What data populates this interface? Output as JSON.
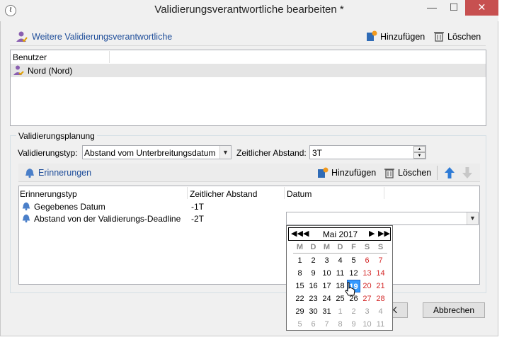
{
  "window": {
    "title": "Validierungsverantwortliche bearbeiten *"
  },
  "responsibles": {
    "section_label": "Weitere Validierungsverantwortliche",
    "add_label": "Hinzufügen",
    "delete_label": "Löschen",
    "column_header": "Benutzer",
    "rows": [
      {
        "user": "Nord (Nord)"
      }
    ]
  },
  "planning": {
    "legend": "Validierungsplanung",
    "type_label": "Validierungstyp:",
    "type_value": "Abstand vom Unterbreitungsdatum",
    "interval_label": "Zeitlicher Abstand:",
    "interval_value": "3T"
  },
  "reminders": {
    "section_label": "Erinnerungen",
    "add_label": "Hinzufügen",
    "delete_label": "Löschen",
    "columns": [
      "Erinnerungstyp",
      "Zeitlicher Abstand",
      "Datum"
    ],
    "rows": [
      {
        "type": "Gegebenes Datum",
        "interval": "-1T",
        "date": ""
      },
      {
        "type": "Abstand von der Validierungs-Deadline",
        "interval": "-2T",
        "date": ""
      }
    ]
  },
  "calendar": {
    "month_label": "Mai 2017",
    "day_names": [
      "M",
      "D",
      "M",
      "D",
      "F",
      "S",
      "S"
    ],
    "weeks": [
      [
        {
          "d": "1"
        },
        {
          "d": "2"
        },
        {
          "d": "3"
        },
        {
          "d": "4"
        },
        {
          "d": "5"
        },
        {
          "d": "6",
          "we": true
        },
        {
          "d": "7",
          "we": true
        }
      ],
      [
        {
          "d": "8"
        },
        {
          "d": "9"
        },
        {
          "d": "10"
        },
        {
          "d": "11"
        },
        {
          "d": "12"
        },
        {
          "d": "13",
          "we": true
        },
        {
          "d": "14",
          "we": true
        }
      ],
      [
        {
          "d": "15"
        },
        {
          "d": "16"
        },
        {
          "d": "17"
        },
        {
          "d": "18"
        },
        {
          "d": "19",
          "sel": true
        },
        {
          "d": "20",
          "we": true
        },
        {
          "d": "21",
          "we": true
        }
      ],
      [
        {
          "d": "22"
        },
        {
          "d": "23"
        },
        {
          "d": "24"
        },
        {
          "d": "25"
        },
        {
          "d": "26"
        },
        {
          "d": "27",
          "we": true
        },
        {
          "d": "28",
          "we": true
        }
      ],
      [
        {
          "d": "29"
        },
        {
          "d": "30"
        },
        {
          "d": "31"
        },
        {
          "d": "1",
          "gray": true
        },
        {
          "d": "2",
          "gray": true
        },
        {
          "d": "3",
          "gray": true
        },
        {
          "d": "4",
          "gray": true
        }
      ],
      [
        {
          "d": "5",
          "gray": true
        },
        {
          "d": "6",
          "gray": true
        },
        {
          "d": "7",
          "gray": true
        },
        {
          "d": "8",
          "gray": true
        },
        {
          "d": "9",
          "gray": true
        },
        {
          "d": "10",
          "gray": true
        },
        {
          "d": "11",
          "gray": true
        }
      ]
    ]
  },
  "buttons": {
    "ok_label": "K",
    "cancel_label": "Abbrechen"
  },
  "colors": {
    "accent": "#3399ff",
    "weekend": "#d42a2a",
    "link": "#1f4e9a",
    "close": "#c75050"
  }
}
